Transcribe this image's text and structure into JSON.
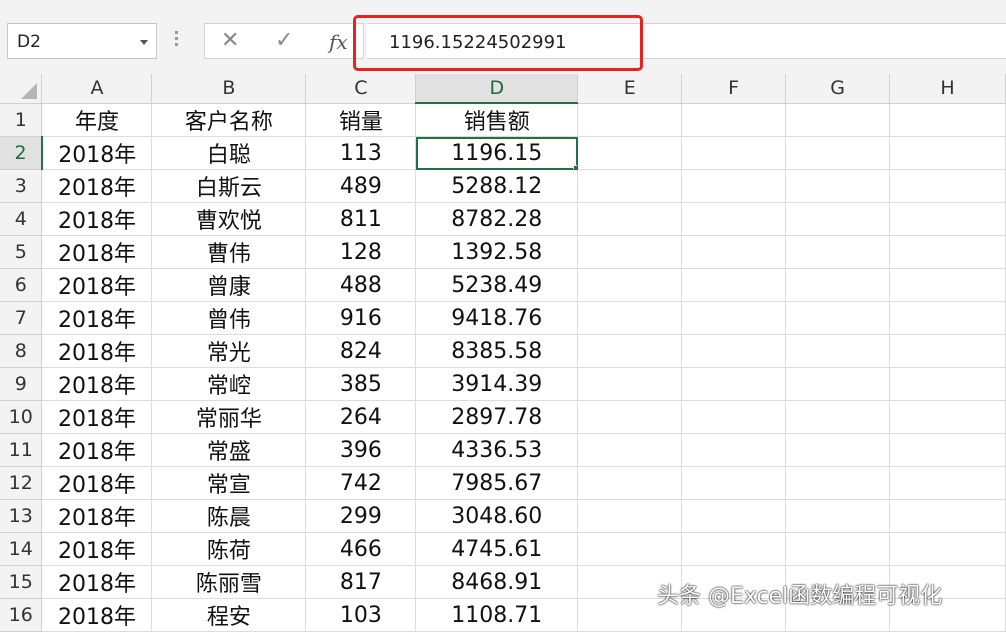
{
  "formula_bar": {
    "name_box": "D2",
    "formula_value": "1196.15224502991",
    "cancel_icon": "cross-icon",
    "enter_icon": "check-icon",
    "function_icon": "fx-icon"
  },
  "sheet": {
    "columns": [
      "A",
      "B",
      "C",
      "D",
      "E",
      "F",
      "G",
      "H"
    ],
    "selected_column": "D",
    "selected_row": "2",
    "active_cell": "D2",
    "rows": [
      {
        "row": "1",
        "cells": [
          "年度",
          "客户名称",
          "销量",
          "销售额"
        ]
      },
      {
        "row": "2",
        "cells": [
          "2018年",
          "白聪",
          "113",
          "1196.15"
        ]
      },
      {
        "row": "3",
        "cells": [
          "2018年",
          "白斯云",
          "489",
          "5288.12"
        ]
      },
      {
        "row": "4",
        "cells": [
          "2018年",
          "曹欢悦",
          "811",
          "8782.28"
        ]
      },
      {
        "row": "5",
        "cells": [
          "2018年",
          "曹伟",
          "128",
          "1392.58"
        ]
      },
      {
        "row": "6",
        "cells": [
          "2018年",
          "曾康",
          "488",
          "5238.49"
        ]
      },
      {
        "row": "7",
        "cells": [
          "2018年",
          "曾伟",
          "916",
          "9418.76"
        ]
      },
      {
        "row": "8",
        "cells": [
          "2018年",
          "常光",
          "824",
          "8385.58"
        ]
      },
      {
        "row": "9",
        "cells": [
          "2018年",
          "常崆",
          "385",
          "3914.39"
        ]
      },
      {
        "row": "10",
        "cells": [
          "2018年",
          "常丽华",
          "264",
          "2897.78"
        ]
      },
      {
        "row": "11",
        "cells": [
          "2018年",
          "常盛",
          "396",
          "4336.53"
        ]
      },
      {
        "row": "12",
        "cells": [
          "2018年",
          "常宣",
          "742",
          "7985.67"
        ]
      },
      {
        "row": "13",
        "cells": [
          "2018年",
          "陈晨",
          "299",
          "3048.60"
        ]
      },
      {
        "row": "14",
        "cells": [
          "2018年",
          "陈荷",
          "466",
          "4745.61"
        ]
      },
      {
        "row": "15",
        "cells": [
          "2018年",
          "陈丽雪",
          "817",
          "8468.91"
        ]
      },
      {
        "row": "16",
        "cells": [
          "2018年",
          "程安",
          "103",
          "1108.71"
        ]
      }
    ]
  },
  "watermark": "头条 @Excel函数编程可视化",
  "colors": {
    "accent": "#217346",
    "highlight": "#e8231f"
  }
}
